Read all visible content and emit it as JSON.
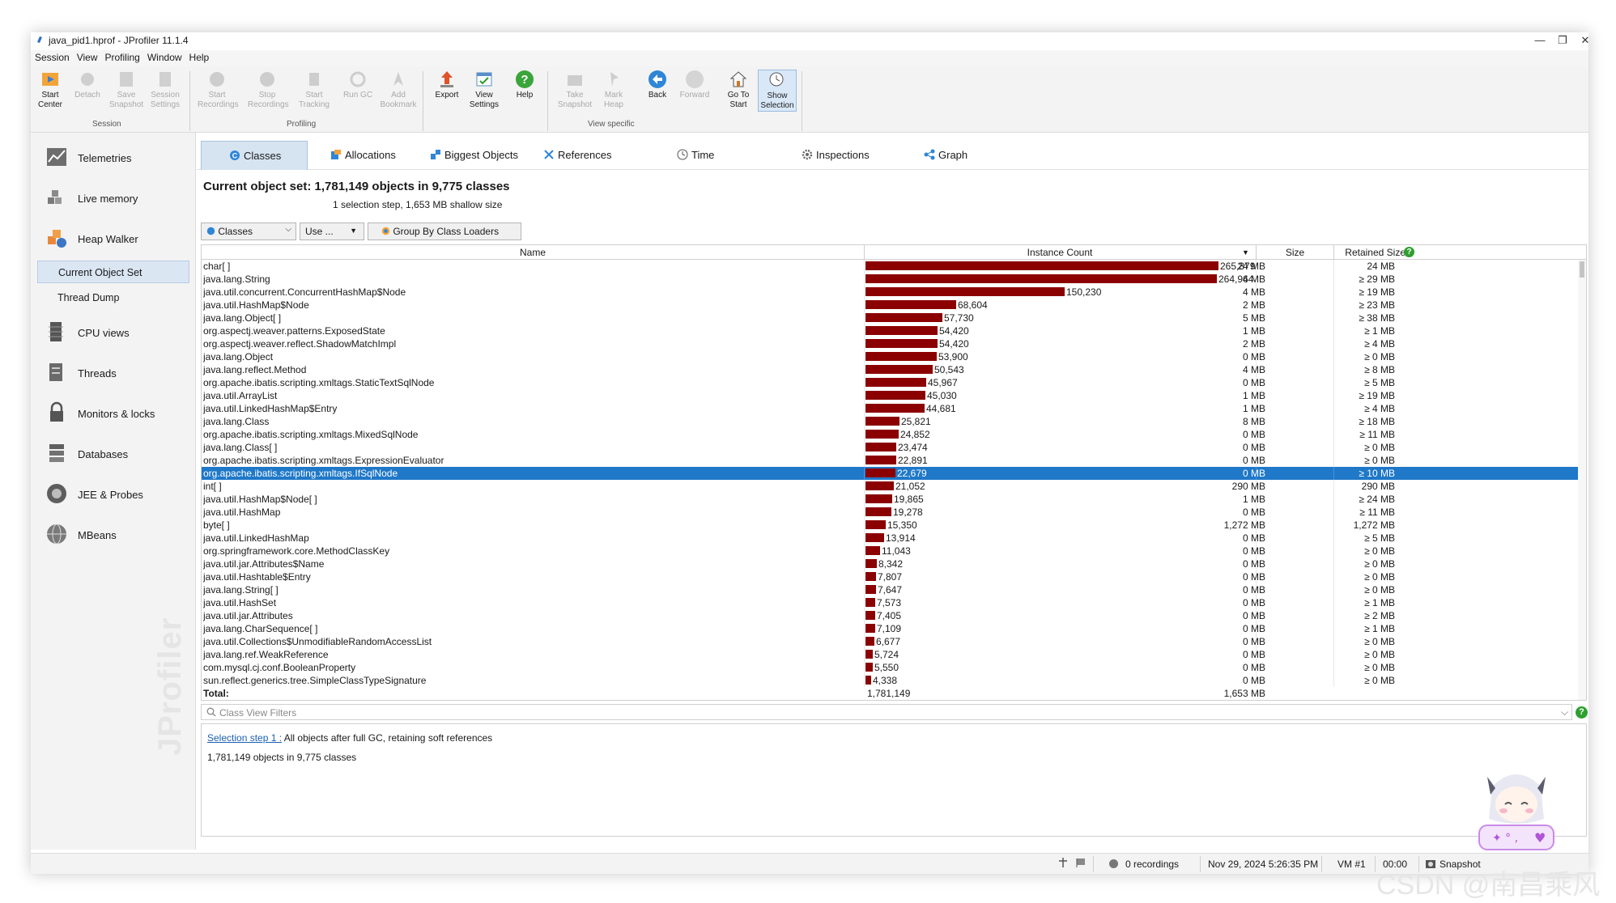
{
  "window": {
    "title": "java_pid1.hprof - JProfiler 11.1.4",
    "minimize_glyph": "—",
    "restore_glyph": "❐",
    "close_glyph": "✕"
  },
  "menu": [
    "Session",
    "View",
    "Profiling",
    "Window",
    "Help"
  ],
  "toolbar": {
    "buttons": [
      {
        "label": "Start\nCenter",
        "icon": "start-center-icon",
        "enabled": true
      },
      {
        "label": "Detach",
        "icon": "detach-icon",
        "enabled": false
      },
      {
        "label": "Save\nSnapshot",
        "icon": "save-snapshot-icon",
        "enabled": false
      },
      {
        "label": "Session\nSettings",
        "icon": "session-settings-icon",
        "enabled": false
      },
      {
        "label": "Start\nRecordings",
        "icon": "start-recordings-icon",
        "enabled": false
      },
      {
        "label": "Stop\nRecordings",
        "icon": "stop-recordings-icon",
        "enabled": false
      },
      {
        "label": "Start\nTracking",
        "icon": "start-tracking-icon",
        "enabled": false
      },
      {
        "label": "Run GC",
        "icon": "run-gc-icon",
        "enabled": false
      },
      {
        "label": "Add\nBookmark",
        "icon": "add-bookmark-icon",
        "enabled": false
      },
      {
        "label": "Export",
        "icon": "export-icon",
        "enabled": true
      },
      {
        "label": "View\nSettings",
        "icon": "view-settings-icon",
        "enabled": true
      },
      {
        "label": "Help",
        "icon": "help-icon",
        "enabled": true
      },
      {
        "label": "Take\nSnapshot",
        "icon": "take-snapshot-icon",
        "enabled": false
      },
      {
        "label": "Mark\nHeap",
        "icon": "mark-heap-icon",
        "enabled": false
      },
      {
        "label": "Back",
        "icon": "back-icon",
        "enabled": true
      },
      {
        "label": "Forward",
        "icon": "forward-icon",
        "enabled": false
      },
      {
        "label": "Go To\nStart",
        "icon": "go-to-start-icon",
        "enabled": true
      },
      {
        "label": "Show\nSelection",
        "icon": "show-selection-icon",
        "enabled": true
      }
    ],
    "groups": [
      "Session",
      "Profiling",
      "View specific"
    ]
  },
  "sidebar": {
    "items": [
      {
        "label": "Telemetries",
        "icon": "telemetries-icon"
      },
      {
        "label": "Live memory",
        "icon": "live-memory-icon"
      },
      {
        "label": "Heap Walker",
        "icon": "heap-walker-icon"
      },
      {
        "label": "CPU views",
        "icon": "cpu-views-icon"
      },
      {
        "label": "Threads",
        "icon": "threads-icon"
      },
      {
        "label": "Monitors & locks",
        "icon": "monitors-locks-icon"
      },
      {
        "label": "Databases",
        "icon": "databases-icon"
      },
      {
        "label": "JEE & Probes",
        "icon": "jee-probes-icon"
      },
      {
        "label": "MBeans",
        "icon": "mbeans-icon"
      }
    ],
    "subitems": [
      {
        "label": "Current Object Set",
        "selected": true
      },
      {
        "label": "Thread Dump",
        "selected": false
      }
    ],
    "watermark": "JProfiler"
  },
  "tabs": [
    {
      "label": "Classes",
      "icon": "classes-icon",
      "selected": true
    },
    {
      "label": "Allocations",
      "icon": "allocations-icon",
      "selected": false
    },
    {
      "label": "Biggest Objects",
      "icon": "biggest-objects-icon",
      "selected": false
    },
    {
      "label": "References",
      "icon": "references-icon",
      "selected": false
    },
    {
      "label": "Time",
      "icon": "time-icon",
      "selected": false
    },
    {
      "label": "Inspections",
      "icon": "inspections-icon",
      "selected": false
    },
    {
      "label": "Graph",
      "icon": "graph-icon",
      "selected": false
    }
  ],
  "object_set": {
    "title": "Current object set:  1,781,149 objects in 9,775 classes",
    "subtitle": "1 selection step, 1,653 MB shallow size"
  },
  "controls": {
    "view_select": "Classes",
    "use_button": "Use ...",
    "group_button": "Group By Class Loaders"
  },
  "table": {
    "columns": [
      "Name",
      "Instance Count",
      "Size",
      "Retained Size"
    ],
    "max_count": 265879,
    "selected_row": 16,
    "rows": [
      {
        "name": "char[ ]",
        "count": 265879,
        "count_text": "265,879",
        "size": "24 MB",
        "retained": "24 MB"
      },
      {
        "name": "java.lang.String",
        "count": 264944,
        "count_text": "264,944",
        "size": "6 MB",
        "retained": "≥ 29 MB"
      },
      {
        "name": "java.util.concurrent.ConcurrentHashMap$Node",
        "count": 150230,
        "count_text": "150,230",
        "size": "4 MB",
        "retained": "≥ 19 MB"
      },
      {
        "name": "java.util.HashMap$Node",
        "count": 68604,
        "count_text": "68,604",
        "size": "2 MB",
        "retained": "≥ 23 MB"
      },
      {
        "name": "java.lang.Object[ ]",
        "count": 57730,
        "count_text": "57,730",
        "size": "5 MB",
        "retained": "≥ 38 MB"
      },
      {
        "name": "org.aspectj.weaver.patterns.ExposedState",
        "count": 54420,
        "count_text": "54,420",
        "size": "1 MB",
        "retained": "≥ 1 MB"
      },
      {
        "name": "org.aspectj.weaver.reflect.ShadowMatchImpl",
        "count": 54420,
        "count_text": "54,420",
        "size": "2 MB",
        "retained": "≥ 4 MB"
      },
      {
        "name": "java.lang.Object",
        "count": 53900,
        "count_text": "53,900",
        "size": "0 MB",
        "retained": "≥ 0 MB"
      },
      {
        "name": "java.lang.reflect.Method",
        "count": 50543,
        "count_text": "50,543",
        "size": "4 MB",
        "retained": "≥ 8 MB"
      },
      {
        "name": "org.apache.ibatis.scripting.xmltags.StaticTextSqlNode",
        "count": 45967,
        "count_text": "45,967",
        "size": "0 MB",
        "retained": "≥ 5 MB"
      },
      {
        "name": "java.util.ArrayList",
        "count": 45030,
        "count_text": "45,030",
        "size": "1 MB",
        "retained": "≥ 19 MB"
      },
      {
        "name": "java.util.LinkedHashMap$Entry",
        "count": 44681,
        "count_text": "44,681",
        "size": "1 MB",
        "retained": "≥ 4 MB"
      },
      {
        "name": "java.lang.Class",
        "count": 25821,
        "count_text": "25,821",
        "size": "8 MB",
        "retained": "≥ 18 MB"
      },
      {
        "name": "org.apache.ibatis.scripting.xmltags.MixedSqlNode",
        "count": 24852,
        "count_text": "24,852",
        "size": "0 MB",
        "retained": "≥ 11 MB"
      },
      {
        "name": "java.lang.Class[ ]",
        "count": 23474,
        "count_text": "23,474",
        "size": "0 MB",
        "retained": "≥ 0 MB"
      },
      {
        "name": "org.apache.ibatis.scripting.xmltags.ExpressionEvaluator",
        "count": 22891,
        "count_text": "22,891",
        "size": "0 MB",
        "retained": "≥ 0 MB"
      },
      {
        "name": "org.apache.ibatis.scripting.xmltags.IfSqlNode",
        "count": 22679,
        "count_text": "22,679",
        "size": "0 MB",
        "retained": "≥ 10 MB"
      },
      {
        "name": "int[ ]",
        "count": 21052,
        "count_text": "21,052",
        "size": "290 MB",
        "retained": "290 MB"
      },
      {
        "name": "java.util.HashMap$Node[ ]",
        "count": 19865,
        "count_text": "19,865",
        "size": "1 MB",
        "retained": "≥ 24 MB"
      },
      {
        "name": "java.util.HashMap",
        "count": 19278,
        "count_text": "19,278",
        "size": "0 MB",
        "retained": "≥ 11 MB"
      },
      {
        "name": "byte[ ]",
        "count": 15350,
        "count_text": "15,350",
        "size": "1,272 MB",
        "retained": "1,272 MB"
      },
      {
        "name": "java.util.LinkedHashMap",
        "count": 13914,
        "count_text": "13,914",
        "size": "0 MB",
        "retained": "≥ 5 MB"
      },
      {
        "name": "org.springframework.core.MethodClassKey",
        "count": 11043,
        "count_text": "11,043",
        "size": "0 MB",
        "retained": "≥ 0 MB"
      },
      {
        "name": "java.util.jar.Attributes$Name",
        "count": 8342,
        "count_text": "8,342",
        "size": "0 MB",
        "retained": "≥ 0 MB"
      },
      {
        "name": "java.util.Hashtable$Entry",
        "count": 7807,
        "count_text": "7,807",
        "size": "0 MB",
        "retained": "≥ 0 MB"
      },
      {
        "name": "java.lang.String[ ]",
        "count": 7647,
        "count_text": "7,647",
        "size": "0 MB",
        "retained": "≥ 0 MB"
      },
      {
        "name": "java.util.HashSet",
        "count": 7573,
        "count_text": "7,573",
        "size": "0 MB",
        "retained": "≥ 1 MB"
      },
      {
        "name": "java.util.jar.Attributes",
        "count": 7405,
        "count_text": "7,405",
        "size": "0 MB",
        "retained": "≥ 2 MB"
      },
      {
        "name": "java.lang.CharSequence[ ]",
        "count": 7109,
        "count_text": "7,109",
        "size": "0 MB",
        "retained": "≥ 1 MB"
      },
      {
        "name": "java.util.Collections$UnmodifiableRandomAccessList",
        "count": 6677,
        "count_text": "6,677",
        "size": "0 MB",
        "retained": "≥ 0 MB"
      },
      {
        "name": "java.lang.ref.WeakReference",
        "count": 5724,
        "count_text": "5,724",
        "size": "0 MB",
        "retained": "≥ 0 MB"
      },
      {
        "name": "com.mysql.cj.conf.BooleanProperty",
        "count": 5550,
        "count_text": "5,550",
        "size": "0 MB",
        "retained": "≥ 0 MB"
      },
      {
        "name": "sun.reflect.generics.tree.SimpleClassTypeSignature",
        "count": 4338,
        "count_text": "4,338",
        "size": "0 MB",
        "retained": "≥ 0 MB"
      }
    ],
    "total": {
      "label": "Total:",
      "count_text": "1,781,149",
      "size": "1,653 MB"
    }
  },
  "filter": {
    "placeholder": "Class View Filters"
  },
  "info": {
    "step_link": "Selection step 1 :",
    "step_text": " All objects after full GC, retaining soft references",
    "summary": "1,781,149 objects in 9,775 classes"
  },
  "statusbar": {
    "recordings": "0 recordings",
    "datetime": "Nov 29, 2024 5:26:35 PM",
    "vm": "VM #1",
    "time": "00:00",
    "mode": "Snapshot"
  },
  "watermark_text": "CSDN @南昌乘风",
  "colors": {
    "bar": "#8b0000",
    "selection": "#1f78c8",
    "help_green": "#2fa02f"
  }
}
